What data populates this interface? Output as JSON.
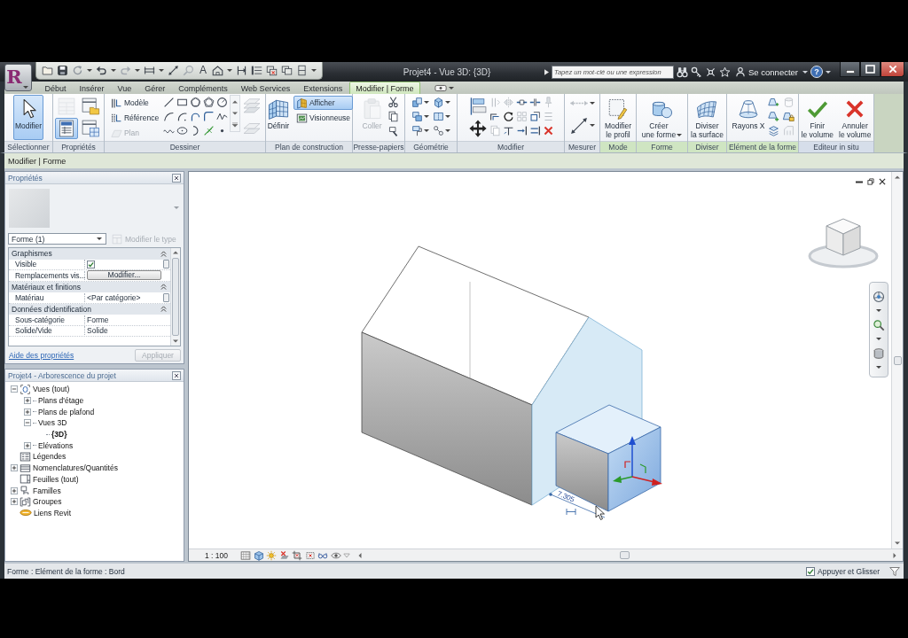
{
  "window": {
    "title": "Projet4 - Vue 3D: {3D}"
  },
  "application_menu": {
    "label": "R"
  },
  "quick_access": {
    "text_tool": "A"
  },
  "search": {
    "placeholder": "Tapez un mot-clé ou une expression"
  },
  "account": {
    "label": "Se connecter"
  },
  "help": {
    "label": "?"
  },
  "tabs": [
    {
      "label": "Début",
      "selected": false
    },
    {
      "label": "Insérer",
      "selected": false
    },
    {
      "label": "Vue",
      "selected": false
    },
    {
      "label": "Gérer",
      "selected": false
    },
    {
      "label": "Compléments",
      "selected": false
    },
    {
      "label": "Web Services",
      "selected": false
    },
    {
      "label": "Extensions",
      "selected": false
    },
    {
      "label": "Modifier | Forme",
      "selected": true
    }
  ],
  "ribbon": {
    "panels": [
      {
        "kind": "select",
        "label": "Sélectionner",
        "contextual": false,
        "buttons": [
          {
            "label": "Modifier",
            "selected": true,
            "disabled": false
          }
        ]
      },
      {
        "kind": "properties",
        "label": "Propriétés",
        "contextual": false,
        "buttons": [
          {
            "selected": false,
            "disabled": true
          },
          {
            "selected": false,
            "disabled": false
          },
          {
            "selected": true,
            "disabled": false
          },
          {
            "selected": false,
            "disabled": false
          }
        ]
      },
      {
        "kind": "draw",
        "label": "Dessiner",
        "contextual": false,
        "buttons": [
          {
            "label": "Modèle",
            "selected": false,
            "disabled": false
          },
          {
            "label": "Référence",
            "selected": false,
            "disabled": false
          },
          {
            "label": "Plan",
            "selected": false,
            "disabled": true
          }
        ]
      },
      {
        "kind": "workplane",
        "label": "Plan de construction",
        "contextual": false,
        "buttons": [
          {
            "label": "Définir",
            "selected": false,
            "disabled": false
          },
          {
            "label": "Afficher",
            "selected": true,
            "disabled": false
          },
          {
            "label": "Visionneuse",
            "selected": false,
            "disabled": false
          }
        ]
      },
      {
        "kind": "clipboard",
        "label": "Presse-papiers",
        "contextual": false,
        "buttons": [
          {
            "label": "Coller",
            "selected": false,
            "disabled": true
          }
        ]
      },
      {
        "kind": "geometry",
        "label": "Géométrie",
        "contextual": false
      },
      {
        "kind": "modify",
        "label": "Modifier",
        "contextual": false
      },
      {
        "kind": "measure",
        "label": "Mesurer",
        "contextual": false
      },
      {
        "kind": "mode",
        "label": "Mode",
        "contextual": true,
        "buttons": [
          {
            "label": "Modifier le profil",
            "selected": false,
            "disabled": false
          }
        ]
      },
      {
        "kind": "form",
        "label": "Forme",
        "contextual": true,
        "buttons": [
          {
            "label": "Créer une forme",
            "selected": false,
            "disabled": false
          }
        ]
      },
      {
        "kind": "divide",
        "label": "Diviser",
        "contextual": true,
        "buttons": [
          {
            "label": "Diviser la surface",
            "selected": false,
            "disabled": false
          }
        ]
      },
      {
        "kind": "element",
        "label": "Elément de la forme",
        "contextual": true,
        "buttons": [
          {
            "label": "Rayons X",
            "selected": false,
            "disabled": false
          }
        ]
      },
      {
        "kind": "insitu",
        "label": "Editeur in situ",
        "contextual": false,
        "buttons": [
          {
            "label": "Finir le volume",
            "selected": false,
            "disabled": false
          },
          {
            "label": "Annuler le volume",
            "selected": false,
            "disabled": false
          }
        ]
      }
    ]
  },
  "options_bar": {
    "label": "Modifier | Forme"
  },
  "properties": {
    "title": "Propriétés",
    "type_selector": {
      "value": "Forme (1)"
    },
    "edit_type": {
      "label": "Modifier le type",
      "disabled": true
    },
    "groups": [
      {
        "label": "Graphismes",
        "expanded": true,
        "rows": [
          {
            "name": "Visible",
            "kind": "checkbox",
            "checked": true,
            "browse": true
          },
          {
            "name": "Remplacements vis...",
            "kind": "button",
            "value": "Modifier...",
            "browse": false
          }
        ]
      },
      {
        "label": "Matériaux et finitions",
        "expanded": true,
        "rows": [
          {
            "name": "Matériau",
            "kind": "text",
            "value": "<Par catégorie>",
            "browse": true
          }
        ]
      },
      {
        "label": "Données d'identification",
        "expanded": true,
        "rows": [
          {
            "name": "Sous-catégorie",
            "kind": "text",
            "value": "Forme",
            "browse": false
          },
          {
            "name": "Solide/Vide",
            "kind": "text",
            "value": "Solide",
            "browse": false
          }
        ]
      }
    ],
    "help_link": "Aide des propriétés",
    "apply_button": {
      "label": "Appliquer",
      "disabled": true
    }
  },
  "project_browser": {
    "title": "Projet4 - Arborescence du projet",
    "tree": [
      {
        "label": "Vues (tout)",
        "kind": "views",
        "expanded": true,
        "selected": false,
        "children": [
          {
            "label": "Plans d'étage",
            "expanded": false,
            "selected": false
          },
          {
            "label": "Plans de plafond",
            "expanded": false,
            "selected": false
          },
          {
            "label": "Vues 3D",
            "expanded": true,
            "selected": false,
            "children": [
              {
                "label": "{3D}",
                "selected": true
              }
            ]
          },
          {
            "label": "Elévations",
            "expanded": false,
            "selected": false
          }
        ]
      },
      {
        "label": "Légendes",
        "kind": "legends",
        "selected": false
      },
      {
        "label": "Nomenclatures/Quantités",
        "kind": "schedules",
        "expanded": false,
        "selected": false
      },
      {
        "label": "Feuilles (tout)",
        "kind": "sheets",
        "selected": false
      },
      {
        "label": "Familles",
        "kind": "families",
        "expanded": false,
        "selected": false
      },
      {
        "label": "Groupes",
        "kind": "groups",
        "expanded": false,
        "selected": false
      },
      {
        "label": "Liens Revit",
        "kind": "links",
        "selected": false
      }
    ]
  },
  "view": {
    "scale": "1 : 100",
    "dimension": "7.305"
  },
  "status_bar": {
    "text": "Forme : Elément de la forme : Bord",
    "drag_option": {
      "label": "Appuyer et Glisser",
      "checked": true
    }
  }
}
